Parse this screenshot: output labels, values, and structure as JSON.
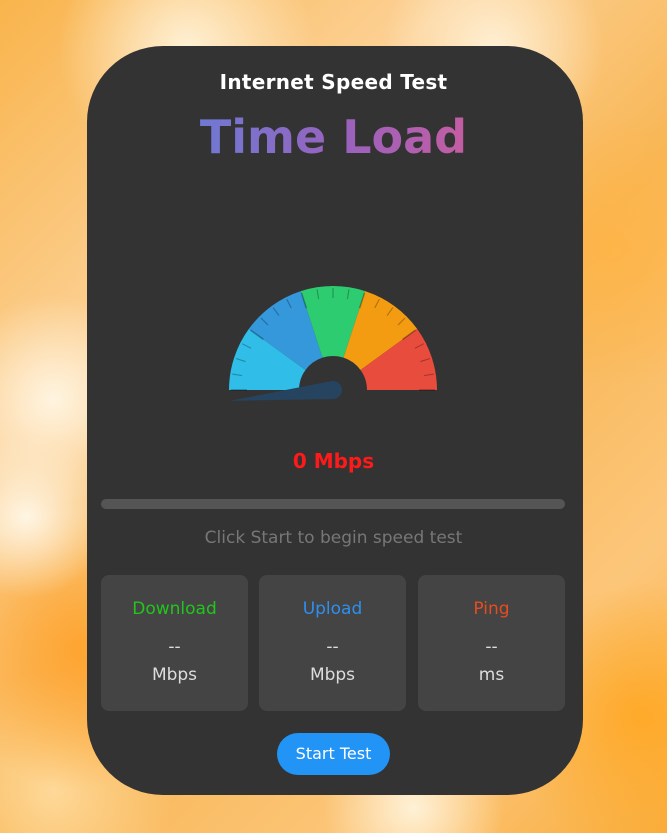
{
  "header": {
    "title": "Internet Speed Test",
    "brand": "Time Load"
  },
  "gauge": {
    "speed_value": 0,
    "speed_display": "0 Mbps",
    "segments": [
      {
        "color": "#30bde8"
      },
      {
        "color": "#3498db"
      },
      {
        "color": "#2ecc71"
      },
      {
        "color": "#f39c12"
      },
      {
        "color": "#e74c3c"
      }
    ],
    "needle_color": "#26445f",
    "hub_color": "#333333"
  },
  "progress": {
    "fraction": 0
  },
  "status_text": "Click Start to begin speed test",
  "stats": [
    {
      "label": "Download",
      "value": "--",
      "unit": "Mbps",
      "color": "#22c51c"
    },
    {
      "label": "Upload",
      "value": "--",
      "unit": "Mbps",
      "color": "#2e8ff0"
    },
    {
      "label": "Ping",
      "value": "--",
      "unit": "ms",
      "color": "#e74c1e"
    }
  ],
  "start_button": {
    "label": "Start Test"
  }
}
